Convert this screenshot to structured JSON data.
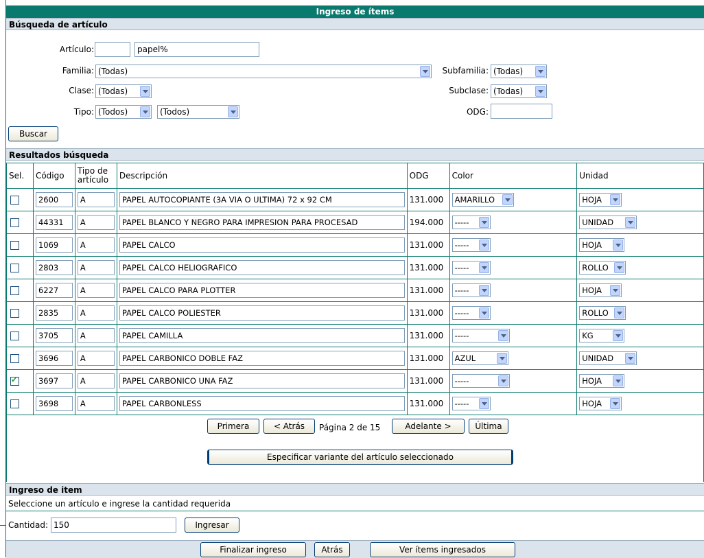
{
  "title": "Ingreso de ítems",
  "search": {
    "section_title": "Búsqueda de artículo",
    "articulo_label": "Artículo:",
    "articulo_code": "",
    "articulo_text": "papel%",
    "familia_label": "Familia:",
    "familia_value": "(Todas)",
    "subfamilia_label": "Subfamilia:",
    "subfamilia_value": "(Todas)",
    "clase_label": "Clase:",
    "clase_value": "(Todas)",
    "subclase_label": "Subclase:",
    "subclase_value": "(Todas)",
    "tipo_label": "Tipo:",
    "tipo_value1": "(Todos)",
    "tipo_value2": "(Todos)",
    "odg_label": "ODG:",
    "odg_value": "",
    "buscar_label": "Buscar"
  },
  "results": {
    "section_title": "Resultados búsqueda",
    "headers": {
      "sel": "Sel.",
      "codigo": "Código",
      "tipo": "Tipo de artículo",
      "descripcion": "Descripción",
      "odg": "ODG",
      "color": "Color",
      "unidad": "Unidad"
    },
    "rows": [
      {
        "checked": false,
        "codigo": "2600",
        "tipo": "A",
        "descripcion": "PAPEL AUTOCOPIANTE (3A VIA O ULTIMA) 72 x 92 CM",
        "odg": "131.000",
        "color": "AMARILLO",
        "unidad": "HOJA"
      },
      {
        "checked": false,
        "codigo": "44331",
        "tipo": "A",
        "descripcion": "PAPEL BLANCO Y NEGRO PARA IMPRESION PARA PROCESAD",
        "odg": "194.000",
        "color": "-----",
        "unidad": "UNIDAD"
      },
      {
        "checked": false,
        "codigo": "1069",
        "tipo": "A",
        "descripcion": "PAPEL CALCO",
        "odg": "131.000",
        "color": "-----",
        "unidad": "HOJA"
      },
      {
        "checked": false,
        "codigo": "2803",
        "tipo": "A",
        "descripcion": "PAPEL CALCO HELIOGRAFICO",
        "odg": "131.000",
        "color": "-----",
        "unidad": "ROLLO"
      },
      {
        "checked": false,
        "codigo": "6227",
        "tipo": "A",
        "descripcion": "PAPEL CALCO PARA PLOTTER",
        "odg": "131.000",
        "color": "-----",
        "unidad": "HOJA"
      },
      {
        "checked": false,
        "codigo": "2835",
        "tipo": "A",
        "descripcion": "PAPEL CALCO POLIESTER",
        "odg": "131.000",
        "color": "-----",
        "unidad": "ROLLO"
      },
      {
        "checked": false,
        "codigo": "3705",
        "tipo": "A",
        "descripcion": "PAPEL CAMILLA",
        "odg": "131.000",
        "color": "-----",
        "unidad": "KG"
      },
      {
        "checked": false,
        "codigo": "3696",
        "tipo": "A",
        "descripcion": "PAPEL CARBONICO DOBLE FAZ",
        "odg": "131.000",
        "color": "AZUL",
        "unidad": "UNIDAD"
      },
      {
        "checked": true,
        "codigo": "3697",
        "tipo": "A",
        "descripcion": "PAPEL CARBONICO UNA FAZ",
        "odg": "131.000",
        "color": "-----",
        "unidad": "HOJA"
      },
      {
        "checked": false,
        "codigo": "3698",
        "tipo": "A",
        "descripcion": "PAPEL CARBONLESS",
        "odg": "131.000",
        "color": "-----",
        "unidad": "HOJA"
      }
    ],
    "pager": {
      "primera": "Primera",
      "atras": "< Atrás",
      "pagina": "Página 2 de 15",
      "adelante": "Adelante >",
      "ultima": "Última"
    },
    "variante_label": "Especificar variante del artículo seleccionado"
  },
  "ingreso": {
    "section_title": "Ingreso de item",
    "instruction": "Seleccione un artículo e ingrese la cantidad requerida",
    "cantidad_label": "Cantidad:",
    "cantidad_value": "150",
    "ingresar_label": "Ingresar"
  },
  "footer": {
    "finalizar_label": "Finalizar ingreso",
    "atras_label": "Atrás",
    "ver_label": "Ver ítems ingresados"
  },
  "colors": {
    "header_bg": "#0a7a6e",
    "section_bg": "#dbe4ec"
  }
}
